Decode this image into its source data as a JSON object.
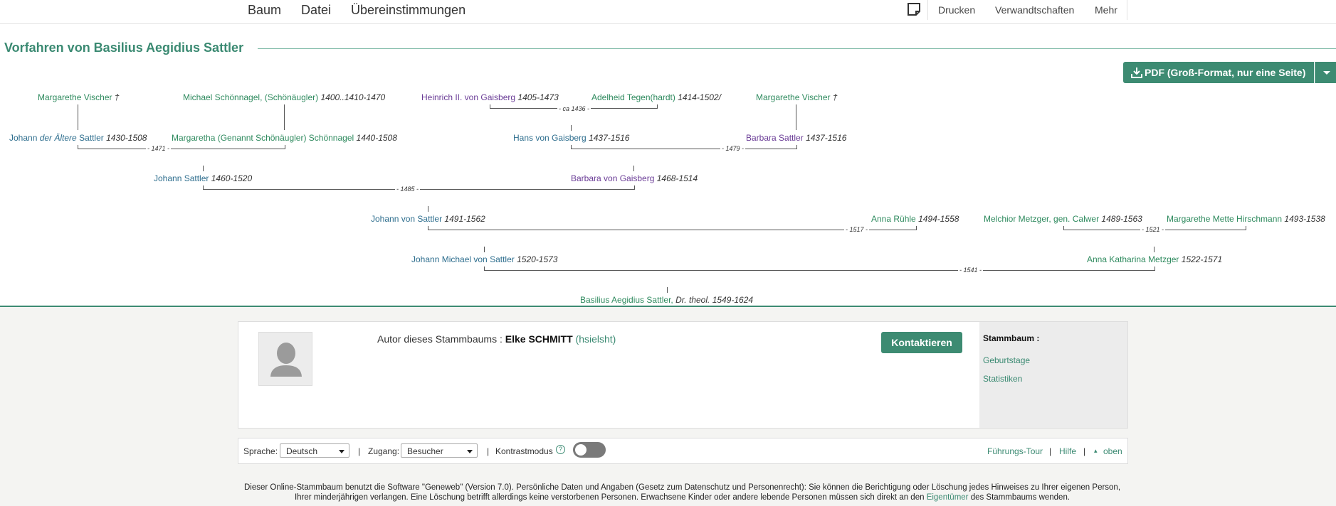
{
  "nav": {
    "left": [
      "Baum",
      "Datei",
      "Übereinstimmungen"
    ],
    "right": [
      "Drucken",
      "Verwandtschaften",
      "Mehr"
    ]
  },
  "title": "Vorfahren von Basilius Aegidius Sattler",
  "pdf_button": "PDF (Groß-Format, nur eine Seite)",
  "tree": {
    "people": {
      "p_mv1": {
        "name": "Margarethe Vischer",
        "dates": "†"
      },
      "p_ms": {
        "name": "Michael Schönnagel, (Schönäugler)",
        "dates": "1400..1410-1470"
      },
      "p_hg2": {
        "name": "Heinrich II. von Gaisberg",
        "dates": "1405-1473"
      },
      "p_at": {
        "name": "Adelheid Tegen(hardt)",
        "dates": "1414-1502/"
      },
      "p_mv2": {
        "name": "Margarethe Vischer",
        "dates": "†"
      },
      "p_jda_pre": "Johann ",
      "p_jda_it": "der Ältere",
      "p_jda_post": " Sattler",
      "p_jda_dates": "1430-1508",
      "p_mgs": {
        "name": "Margaretha (Genannt Schönäugler) Schönnagel",
        "dates": "1440-1508"
      },
      "p_hvg": {
        "name": "Hans von Gaisberg",
        "dates": "1437-1516"
      },
      "p_bs": {
        "name": "Barbara Sattler",
        "dates": "1437-1516"
      },
      "p_js": {
        "name": "Johann Sattler",
        "dates": "1460-1520"
      },
      "p_bvg": {
        "name": "Barbara von Gaisberg",
        "dates": "1468-1514"
      },
      "p_jvs": {
        "name": "Johann von Sattler",
        "dates": "1491-1562"
      },
      "p_ar": {
        "name": "Anna Rühle",
        "dates": "1494-1558"
      },
      "p_mm": {
        "name": "Melchior Metzger, gen. Calwer",
        "dates": "1489-1563"
      },
      "p_mmh": {
        "name": "Margarethe Mette Hirschmann",
        "dates": "1493-1538"
      },
      "p_jmvs": {
        "name": "Johann Michael von Sattler",
        "dates": "1520-1573"
      },
      "p_akm": {
        "name": "Anna Katharina Metzger",
        "dates": "1522-1571"
      },
      "p_bas_name": "Basilius Aegidius Sattler,",
      "p_bas_title": "Dr. theol.",
      "p_bas_dates": "1549-1624"
    },
    "marriages": {
      "m1": "- ca 1436 -",
      "m2": "- 1471 -",
      "m3": "- 1479 -",
      "m4": "- 1485 -",
      "m5": "- 1517 -",
      "m6": "- 1521 -",
      "m7": "- 1541 -"
    }
  },
  "author": {
    "label": "Autor dieses Stammbaums :",
    "name": "Elke SCHMITT",
    "login": "(hsielsht)",
    "contact_button": "Kontaktieren"
  },
  "sidebar": {
    "heading": "Stammbaum :",
    "links": [
      "Geburtstage",
      "Statistiken"
    ]
  },
  "settings": {
    "language_label": "Sprache:",
    "language_value": "Deutsch",
    "access_label": "Zugang:",
    "access_value": "Besucher",
    "contrast_label": "Kontrastmodus",
    "help_symbol": "?",
    "sep": "|",
    "tour": "Führungs-Tour",
    "help": "Hilfe",
    "top_arrow": "▴",
    "top": "oben"
  },
  "disclaimer": {
    "part1": "Dieser Online-Stammbaum benutzt die Software \"Geneweb\" (Version 7.0). Persönliche Daten und Angaben (Gesetz zum Datenschutz und Personenrecht): Sie können die Berichtigung oder Löschung jedes Hinweises zu Ihrer eigenen Person, Ihrer minderjährigen verlangen. Eine Löschung betrifft allerdings keine verstorbenen Personen. Erwachsene Kinder oder andere lebende Personen müssen sich direkt an den ",
    "link": "Eigentümer",
    "part2": " des Stammbaums wenden."
  },
  "colors": {
    "accent": "#3d8b72",
    "male": "#2e6e8e",
    "female": "#6a3c96"
  }
}
